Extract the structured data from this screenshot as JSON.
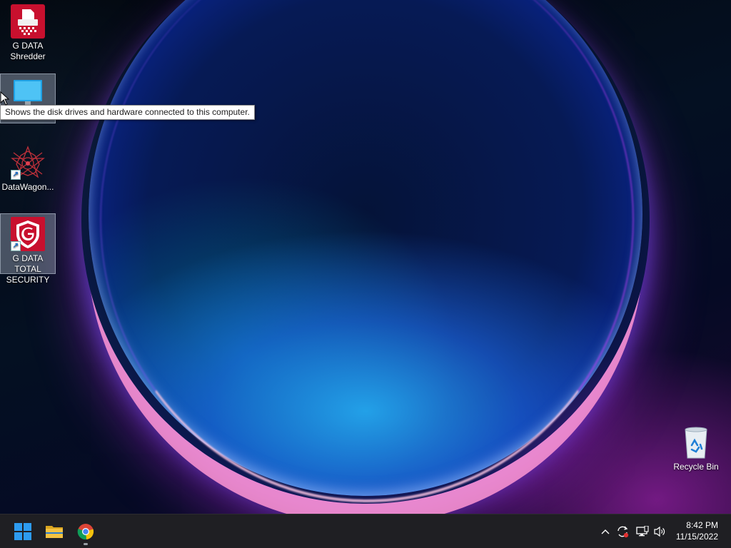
{
  "desktop": {
    "icons": [
      {
        "label_line1": "G DATA",
        "label_line2": "Shredder",
        "icon": "shredder-icon"
      },
      {
        "label": "",
        "icon": "this-pc-icon"
      },
      {
        "label": "DataWagon...",
        "icon": "datawagon-icon"
      },
      {
        "label_line1": "G DATA TOTAL",
        "label_line2": "SECURITY",
        "icon": "gdata-shield-icon"
      },
      {
        "label": "Recycle Bin",
        "icon": "recycle-bin-icon"
      }
    ],
    "tooltip": "Shows the disk drives and hardware connected to this computer."
  },
  "taskbar": {
    "apps": [
      {
        "name": "Start",
        "icon": "windows-start-icon"
      },
      {
        "name": "File Explorer",
        "icon": "folder-icon"
      },
      {
        "name": "Google Chrome",
        "icon": "chrome-icon"
      }
    ],
    "tray": {
      "chevron_glyph": "^",
      "time": "8:42 PM",
      "date": "11/15/2022"
    }
  },
  "colors": {
    "taskbar_bg": "#1f1f23",
    "gdata_red": "#c8102e",
    "windows_blue": "#2d9bf0",
    "folder_yellow": "#f5c242"
  }
}
